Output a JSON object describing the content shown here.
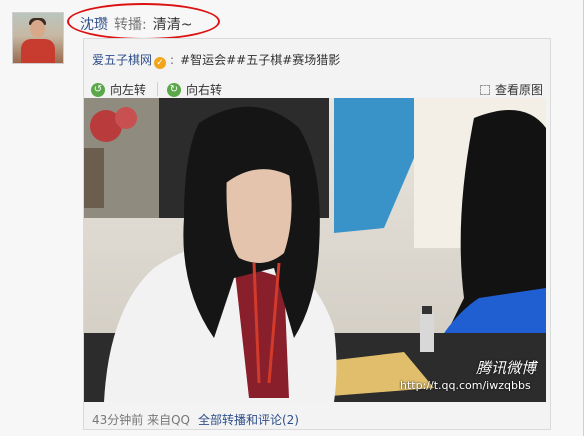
{
  "post": {
    "author": "沈瓒",
    "action": "转播:",
    "repost_text": "清清~"
  },
  "original": {
    "source_name": "爱五子棋网",
    "verified_badge": "verified-icon",
    "separator": ":",
    "tags": "#智运会##五子棋#赛场猎影"
  },
  "toolbar": {
    "rotate_left": "向左转",
    "rotate_right": "向右转",
    "view_original": "查看原图"
  },
  "photo": {
    "watermark_brand": "腾讯微博",
    "watermark_url": "http://t.qq.com/iwzqbbs"
  },
  "footer": {
    "time_source": "43分钟前 来自QQ",
    "comments_link": "全部转播和评论(2)"
  },
  "colors": {
    "link_blue": "#2f4f8a",
    "highlight_red": "#d11111",
    "meta_gray": "#777777"
  }
}
